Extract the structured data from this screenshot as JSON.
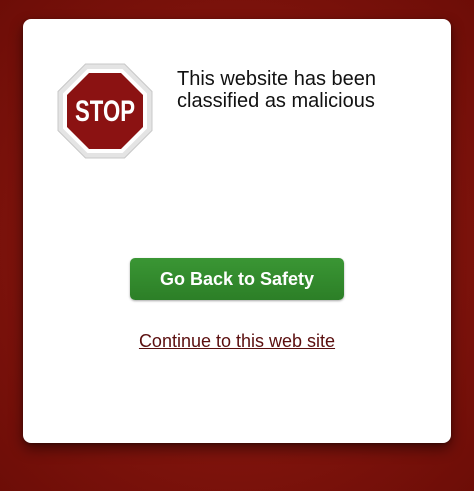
{
  "warning": {
    "stop_sign_text": "STOP",
    "headline": "This website has been classified as malicious"
  },
  "actions": {
    "safety_button_label": "Go Back to Safety",
    "continue_link_label": "Continue to this web site"
  },
  "colors": {
    "backdrop": "#7e130c",
    "card": "#ffffff",
    "stop_sign": "#8b1212",
    "safety_button": "#2f8a2b",
    "link": "#5a0e0e"
  },
  "icons": {
    "stop_sign": "stop-sign-icon"
  }
}
